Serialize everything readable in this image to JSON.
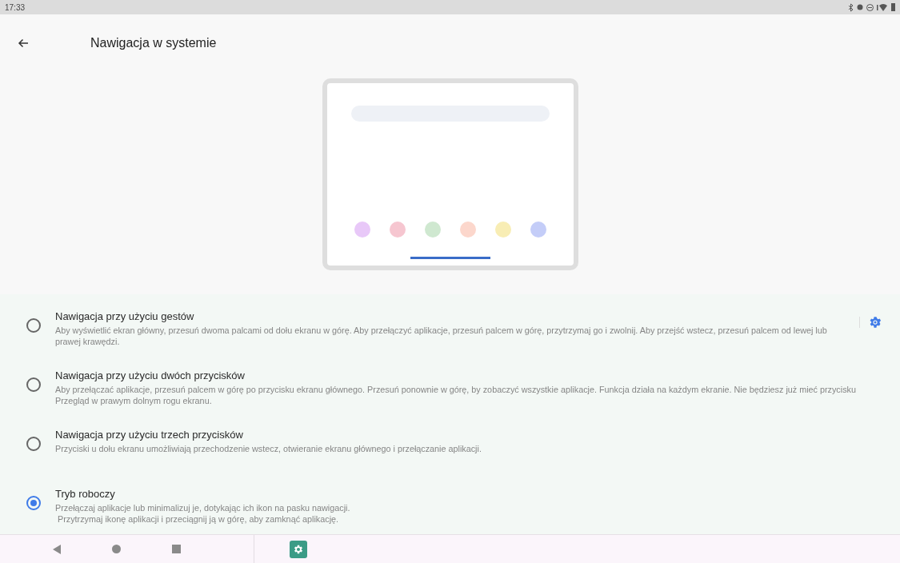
{
  "status_bar": {
    "time": "17:33"
  },
  "header": {
    "title": "Nawigacja w systemie"
  },
  "illustration": {
    "dots": [
      {
        "color": "#e8c8f8"
      },
      {
        "color": "#f6c6d0"
      },
      {
        "color": "#cfe8d0"
      },
      {
        "color": "#fcd7cc"
      },
      {
        "color": "#f8edb4"
      },
      {
        "color": "#c4cdf8"
      }
    ]
  },
  "options": [
    {
      "title": "Nawigacja przy użyciu gestów",
      "description": "Aby wyświetlić ekran główny, przesuń dwoma palcami od dołu ekranu w górę. Aby przełączyć aplikacje, przesuń palcem w górę, przytrzymaj go i zwolnij. Aby przejść wstecz, przesuń palcem od lewej lub prawej krawędzi.",
      "selected": false,
      "has_settings": true
    },
    {
      "title": "Nawigacja przy użyciu dwóch przycisków",
      "description": "Aby przełączać aplikacje, przesuń palcem w górę po przycisku ekranu głównego. Przesuń ponownie w górę, by zobaczyć wszystkie aplikacje. Funkcja działa na każdym ekranie. Nie będziesz już mieć przycisku Przegląd w prawym dolnym rogu ekranu.",
      "selected": false,
      "has_settings": false
    },
    {
      "title": "Nawigacja przy użyciu trzech przycisków",
      "description": "Przyciski u dołu ekranu umożliwiają przechodzenie wstecz, otwieranie ekranu głównego i przełączanie aplikacji.",
      "selected": false,
      "has_settings": false
    },
    {
      "title": "Tryb roboczy",
      "description": "Przełączaj aplikacje lub minimalizuj je, dotykając ich ikon na pasku nawigacji.\n Przytrzymaj ikonę aplikacji i przeciągnij ją w górę, aby zamknąć aplikację.",
      "selected": true,
      "has_settings": false
    }
  ]
}
